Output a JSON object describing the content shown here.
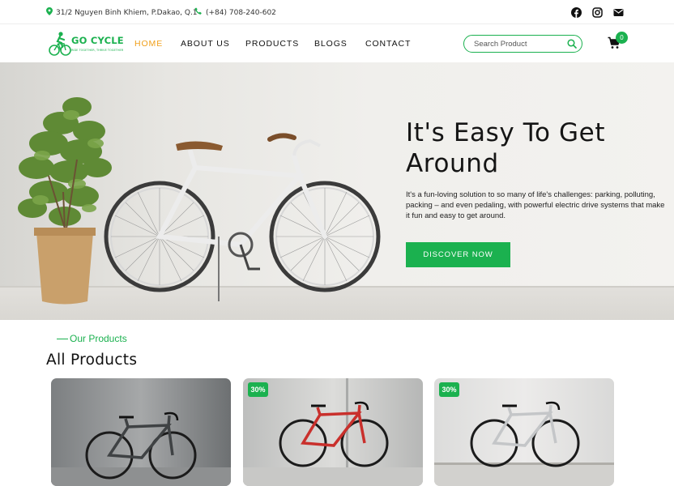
{
  "topbar": {
    "address": "31/2 Nguyen Binh Khiem, P.Dakao, Q.1",
    "phone": "(+84) 708-240-602",
    "social": [
      "facebook-icon",
      "instagram-icon",
      "mail-icon"
    ]
  },
  "brand": {
    "name": "GO CYCLE",
    "tagline": "RIDE TOGETHER, THRIVE TOGETHER",
    "color": "#1bb14f"
  },
  "nav": {
    "items": [
      {
        "label": "HOME",
        "active": true
      },
      {
        "label": "ABOUT US",
        "active": false
      },
      {
        "label": "PRODUCTS",
        "active": false
      },
      {
        "label": "BLOGS",
        "active": false
      },
      {
        "label": "CONTACT",
        "active": false
      }
    ],
    "active_color": "#f0a01c"
  },
  "search": {
    "placeholder": "Search Product"
  },
  "cart": {
    "count": "0"
  },
  "hero": {
    "title": "It's Easy To Get Around",
    "description": "It's a fun-loving solution to so many of life's challenges: parking, polluting, packing – and even pedaling, with powerful electric drive systems that make it fun and easy to get around.",
    "button": "DISCOVER NOW"
  },
  "products": {
    "kicker": "Our Products",
    "title": "All Products",
    "cards": [
      {
        "badge": "",
        "frame_color": "#3f4244"
      },
      {
        "badge": "30%",
        "frame_color": "#c9302c"
      },
      {
        "badge": "30%",
        "frame_color": "#c4c6c8"
      }
    ]
  }
}
